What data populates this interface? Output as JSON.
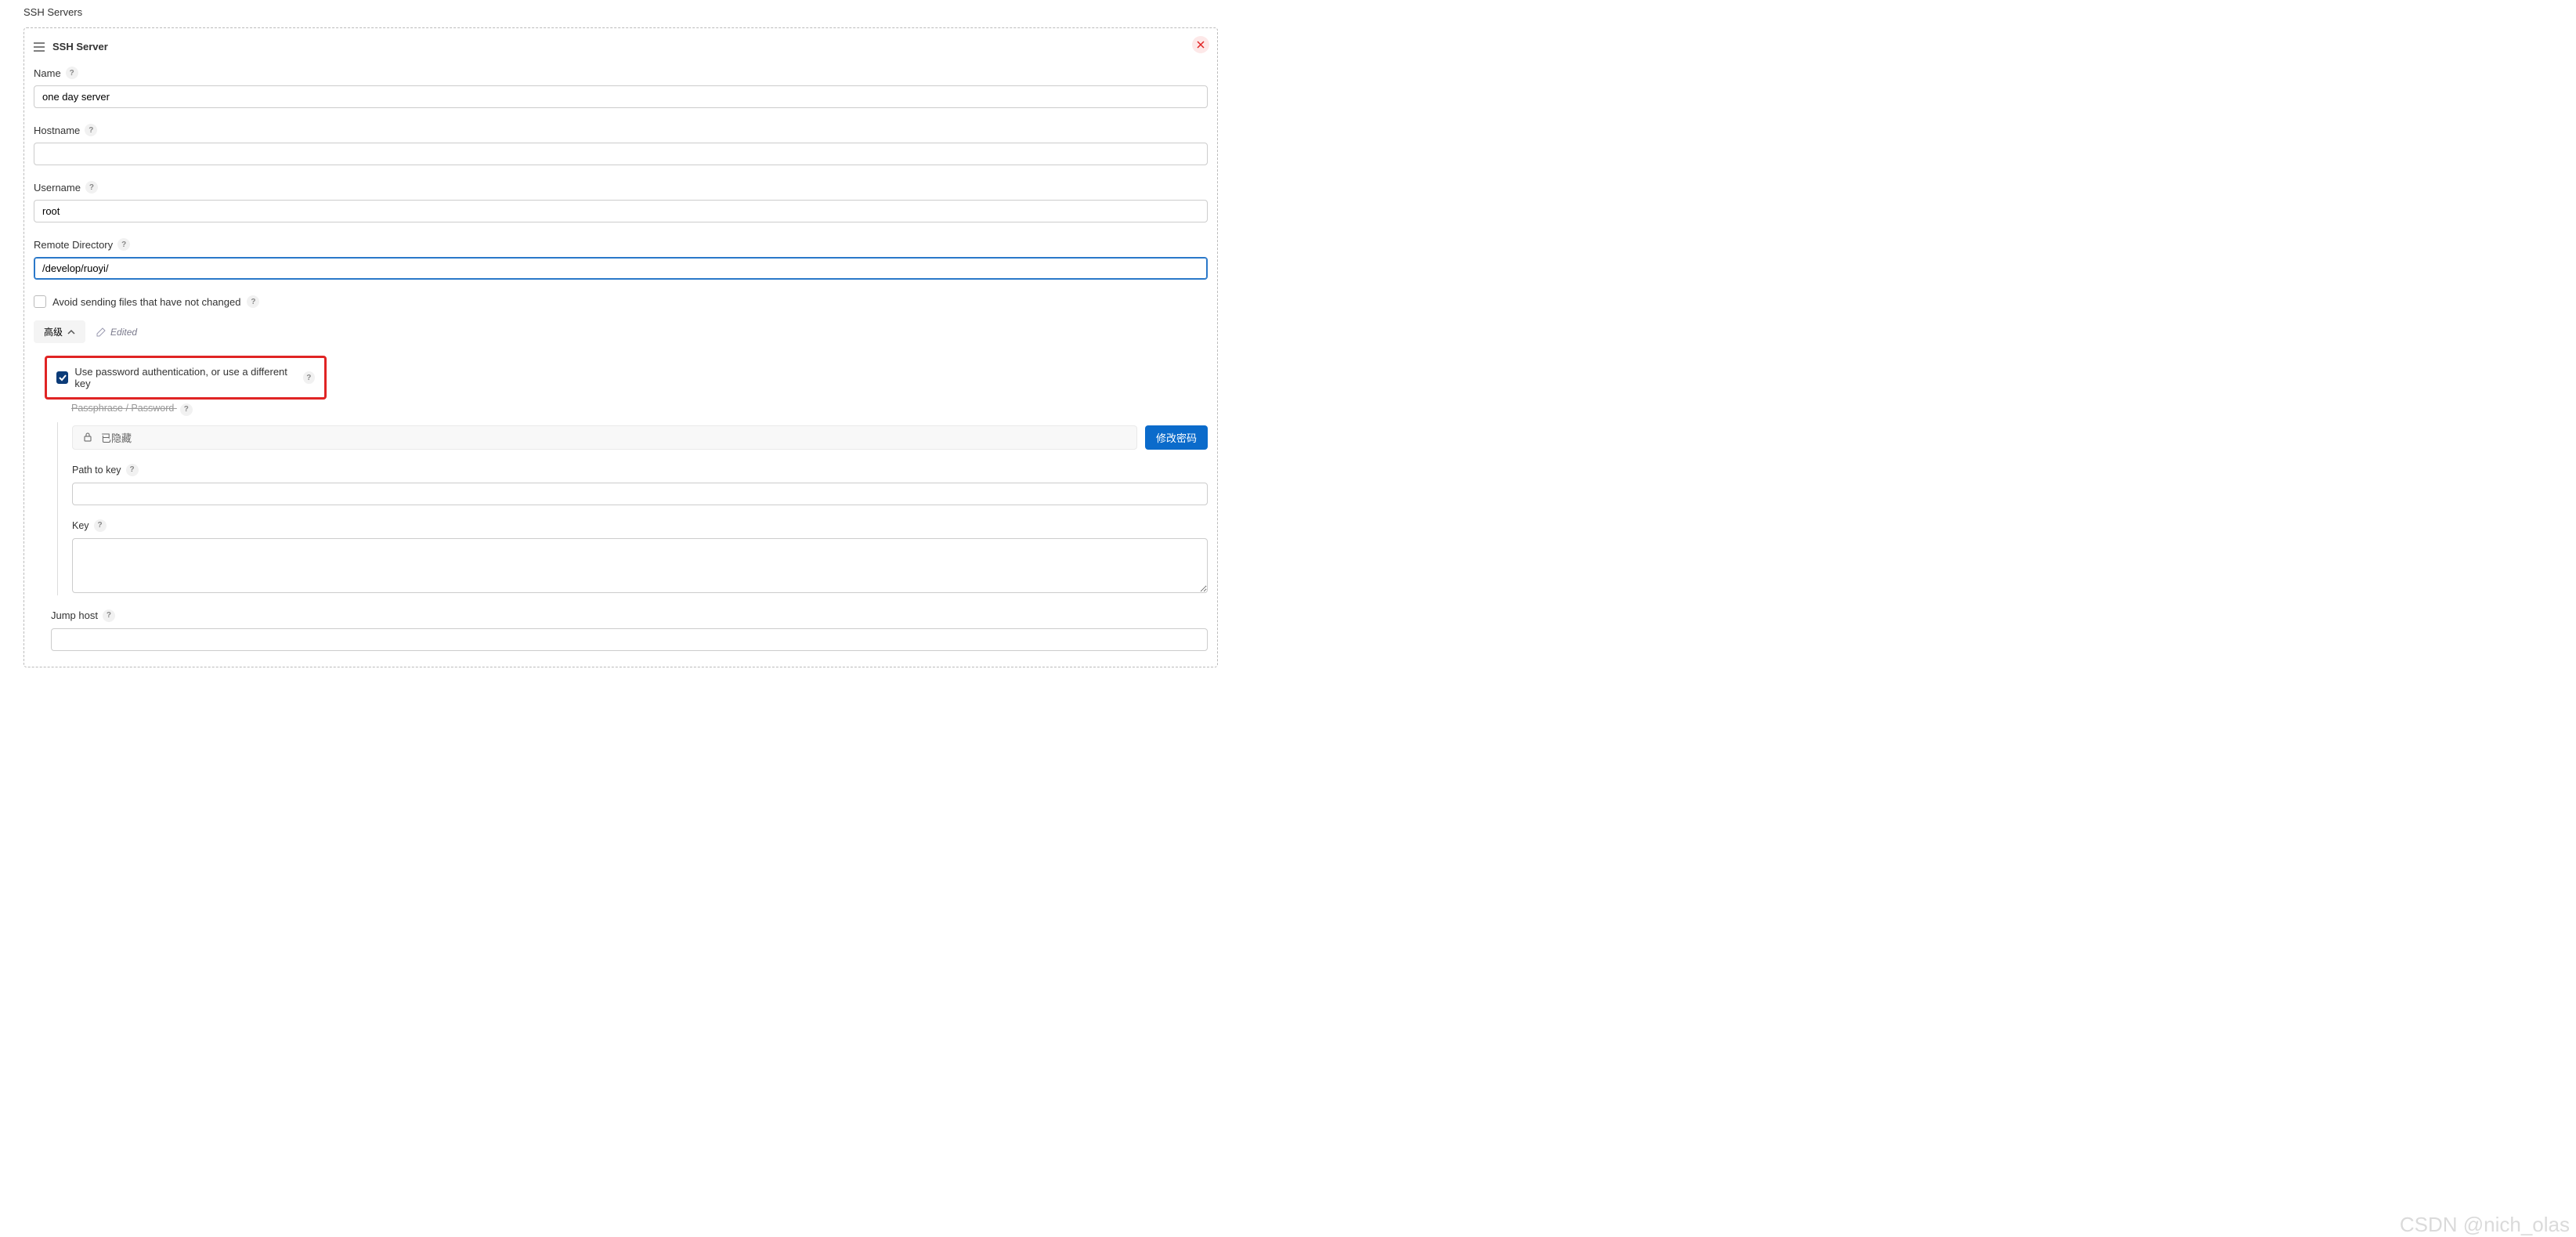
{
  "section_title": "SSH Servers",
  "panel": {
    "title": "SSH Server",
    "fields": {
      "name": {
        "label": "Name",
        "value": "one day server"
      },
      "hostname": {
        "label": "Hostname",
        "value": ""
      },
      "username": {
        "label": "Username",
        "value": "root"
      },
      "remote_dir": {
        "label": "Remote Directory",
        "value": "/develop/ruoyi/"
      },
      "avoid_resend": {
        "label": "Avoid sending files that have not changed",
        "checked": false
      },
      "advanced_btn": "高级",
      "edited_label": "Edited",
      "use_password": {
        "label": "Use password authentication, or use a different key",
        "checked": true
      },
      "passphrase": {
        "label": "Passphrase / Password",
        "hidden_text": "已隐藏",
        "change_btn": "修改密码"
      },
      "path_to_key": {
        "label": "Path to key",
        "value": ""
      },
      "key": {
        "label": "Key",
        "value": ""
      },
      "jump_host": {
        "label": "Jump host",
        "value": ""
      }
    }
  },
  "watermark": "CSDN @nich_olas",
  "help_glyph": "?"
}
